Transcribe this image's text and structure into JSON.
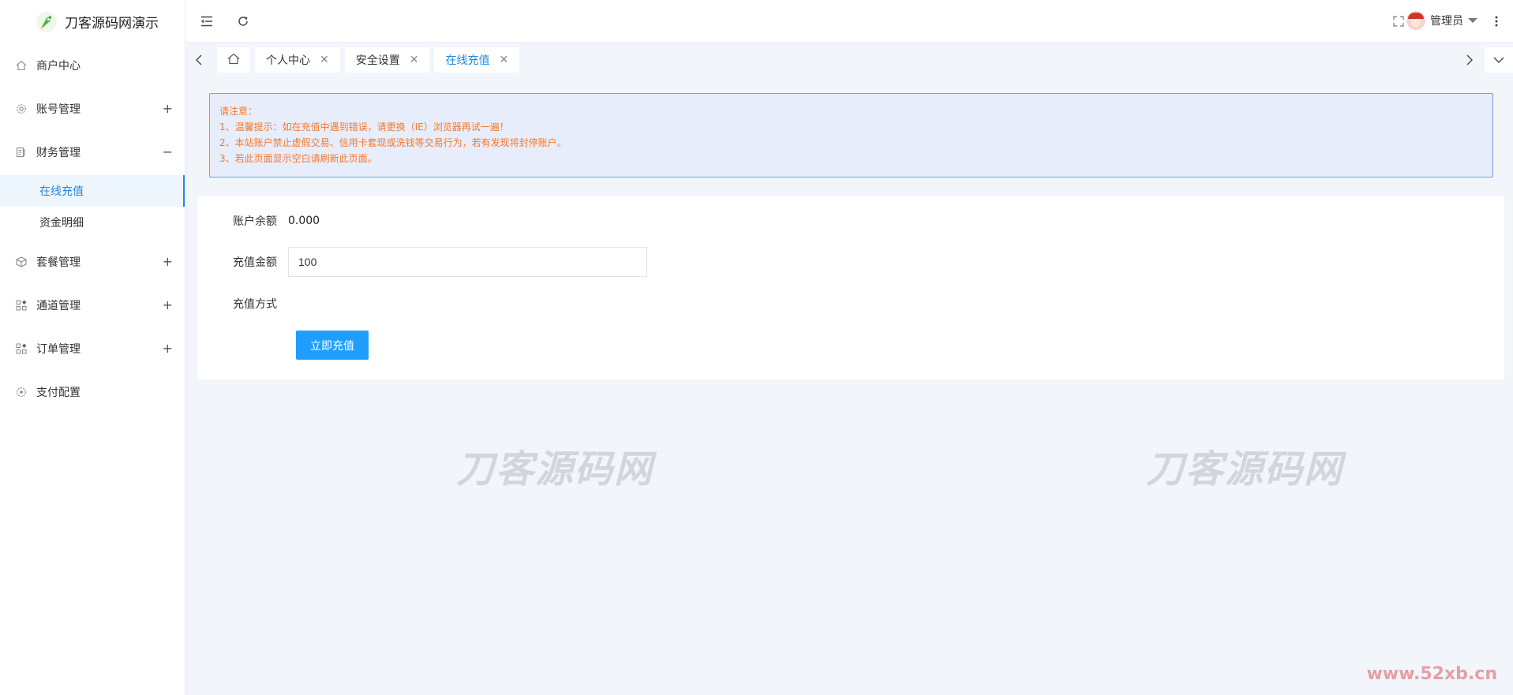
{
  "brand": {
    "title": "刀客源码网演示"
  },
  "sidebar": {
    "items": [
      {
        "label": "商户中心",
        "icon": "home-icon",
        "toggle": ""
      },
      {
        "label": "账号管理",
        "icon": "gear-icon",
        "toggle": "+"
      },
      {
        "label": "财务管理",
        "icon": "finance-icon",
        "toggle": "−"
      },
      {
        "label": "套餐管理",
        "icon": "package-icon",
        "toggle": "+"
      },
      {
        "label": "通道管理",
        "icon": "grid-icon",
        "toggle": "+"
      },
      {
        "label": "订单管理",
        "icon": "grid-icon",
        "toggle": "+"
      },
      {
        "label": "支付配置",
        "icon": "settings-icon",
        "toggle": ""
      }
    ],
    "finance_sub": [
      {
        "label": "在线充值",
        "active": true
      },
      {
        "label": "资金明细",
        "active": false
      }
    ]
  },
  "header": {
    "user_name": "管理员"
  },
  "tabs": [
    {
      "label": "个人中心"
    },
    {
      "label": "安全设置"
    },
    {
      "label": "在线充值"
    }
  ],
  "notice": {
    "title": "请注意：",
    "lines": [
      "1、温馨提示：如在充值中遇到错误，请更换（IE）浏览器再试一遍！",
      "2、本站账户禁止虚假交易、信用卡套现或洗钱等交易行为，若有发现将封停账户。",
      "3、若此页面显示空白请刷新此页面。"
    ]
  },
  "form": {
    "balance_label": "账户余额",
    "balance_value": "0.000",
    "amount_label": "充值金额",
    "amount_value": "100",
    "method_label": "充值方式",
    "submit_label": "立即充值"
  },
  "watermark": {
    "text": "刀客源码网",
    "site": "www.52xb.cn"
  },
  "colors": {
    "accent": "#1e88e5",
    "button": "#1e9fff",
    "notice_text": "#f07b2e",
    "notice_bg": "#e8edfb"
  }
}
